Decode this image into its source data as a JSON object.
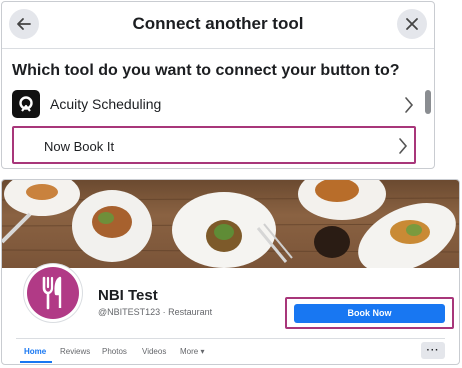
{
  "dialog": {
    "title": "Connect another tool",
    "question": "Which tool do you want to connect your button to?",
    "tools": [
      {
        "label": "Acuity Scheduling",
        "icon": "acuity-logo"
      },
      {
        "label": "Now Book It"
      }
    ]
  },
  "page": {
    "name": "NBI Test",
    "meta": "@NBITEST123 · Restaurant",
    "cta": "Book Now",
    "tabs": [
      "Home",
      "Reviews",
      "Photos",
      "Videos",
      "More ▾"
    ],
    "overflow_label": "···",
    "accent_color": "#1877f2",
    "highlight_color": "#a8367a",
    "avatar_color": "#b13a86"
  }
}
